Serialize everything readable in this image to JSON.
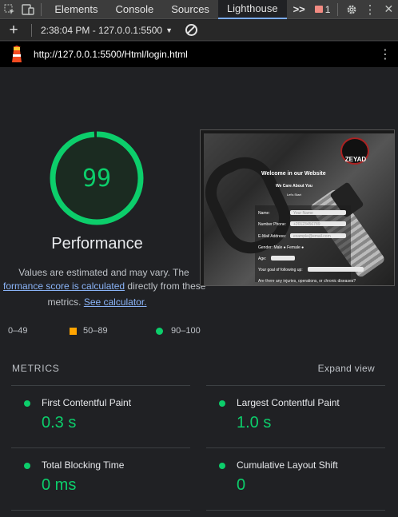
{
  "devtools": {
    "tabs": [
      "Elements",
      "Console",
      "Sources",
      "Lighthouse"
    ],
    "active_tab": "Lighthouse",
    "more_tabs_glyph": ">>",
    "issues_count": "1"
  },
  "toolbar": {
    "report_label": "2:38:04 PM - 127.0.0.1:5500"
  },
  "url_bar": {
    "url": "http://127.0.0.1:5500/Html/login.html"
  },
  "performance": {
    "score": "99",
    "score_fraction": 0.99,
    "title": "Performance",
    "desc_line1": "Values are estimated and may vary. The",
    "desc_line2_link": "formance score is calculated",
    "desc_line2_rest": " directly from these",
    "desc_line3_text": "metrics. ",
    "desc_line3_link": "See calculator."
  },
  "legend": [
    {
      "range": "0–49",
      "color": "#ff4e42"
    },
    {
      "range": "50–89",
      "color": "#ffa400"
    },
    {
      "range": "90–100",
      "color": "#0cce6b"
    }
  ],
  "metrics": {
    "heading": "METRICS",
    "expand_label": "Expand view",
    "items": [
      {
        "name": "First Contentful Paint",
        "value": "0.3 s"
      },
      {
        "name": "Largest Contentful Paint",
        "value": "1.0 s"
      },
      {
        "name": "Total Blocking Time",
        "value": "0 ms"
      },
      {
        "name": "Cumulative Layout Shift",
        "value": "0"
      }
    ]
  },
  "thumbnail": {
    "logo_text": "ZEYAD",
    "welcome": "Welcome in our Website",
    "care": "We Care About You",
    "start": "Let's Start",
    "fields": [
      "Name:",
      "Number Phone:",
      "E-Mail Address:",
      "Gender: Male ● Female ●",
      "Age:",
      "Your goal of following up:",
      "Are there any injuries, operations, or chronic diseases?"
    ],
    "field_values": [
      "Your Name",
      "+20123456789",
      "example@email.com"
    ]
  },
  "colors": {
    "pass": "#0cce6b",
    "average": "#ffa400",
    "fail": "#ff4e42",
    "link": "#8ab4f8"
  }
}
